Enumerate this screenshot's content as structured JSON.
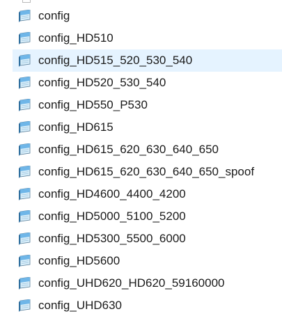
{
  "files": [
    {
      "name": "config",
      "icon": "notepad-file-icon",
      "selected": false
    },
    {
      "name": "config_HD510",
      "icon": "notepad-file-icon",
      "selected": false
    },
    {
      "name": "config_HD515_520_530_540",
      "icon": "notepad-file-icon",
      "selected": true
    },
    {
      "name": "config_HD520_530_540",
      "icon": "notepad-file-icon",
      "selected": false
    },
    {
      "name": "config_HD550_P530",
      "icon": "notepad-file-icon",
      "selected": false
    },
    {
      "name": "config_HD615",
      "icon": "notepad-file-icon",
      "selected": false
    },
    {
      "name": "config_HD615_620_630_640_650",
      "icon": "notepad-file-icon",
      "selected": false
    },
    {
      "name": "config_HD615_620_630_640_650_spoof",
      "icon": "notepad-file-icon",
      "selected": false
    },
    {
      "name": "config_HD4600_4400_4200",
      "icon": "notepad-file-icon",
      "selected": false
    },
    {
      "name": "config_HD5000_5100_5200",
      "icon": "notepad-file-icon",
      "selected": false
    },
    {
      "name": "config_HD5300_5500_6000",
      "icon": "notepad-file-icon",
      "selected": false
    },
    {
      "name": "config_HD5600",
      "icon": "notepad-file-icon",
      "selected": false
    },
    {
      "name": "config_UHD620_HD620_59160000",
      "icon": "notepad-file-icon",
      "selected": false
    },
    {
      "name": "config_UHD630",
      "icon": "notepad-file-icon",
      "selected": false
    }
  ],
  "colors": {
    "selection_background": "#e5f3ff",
    "text": "#1a1a1a",
    "icon_sky_top": "#6fb6e8",
    "icon_sky_bottom": "#d8eefa"
  }
}
